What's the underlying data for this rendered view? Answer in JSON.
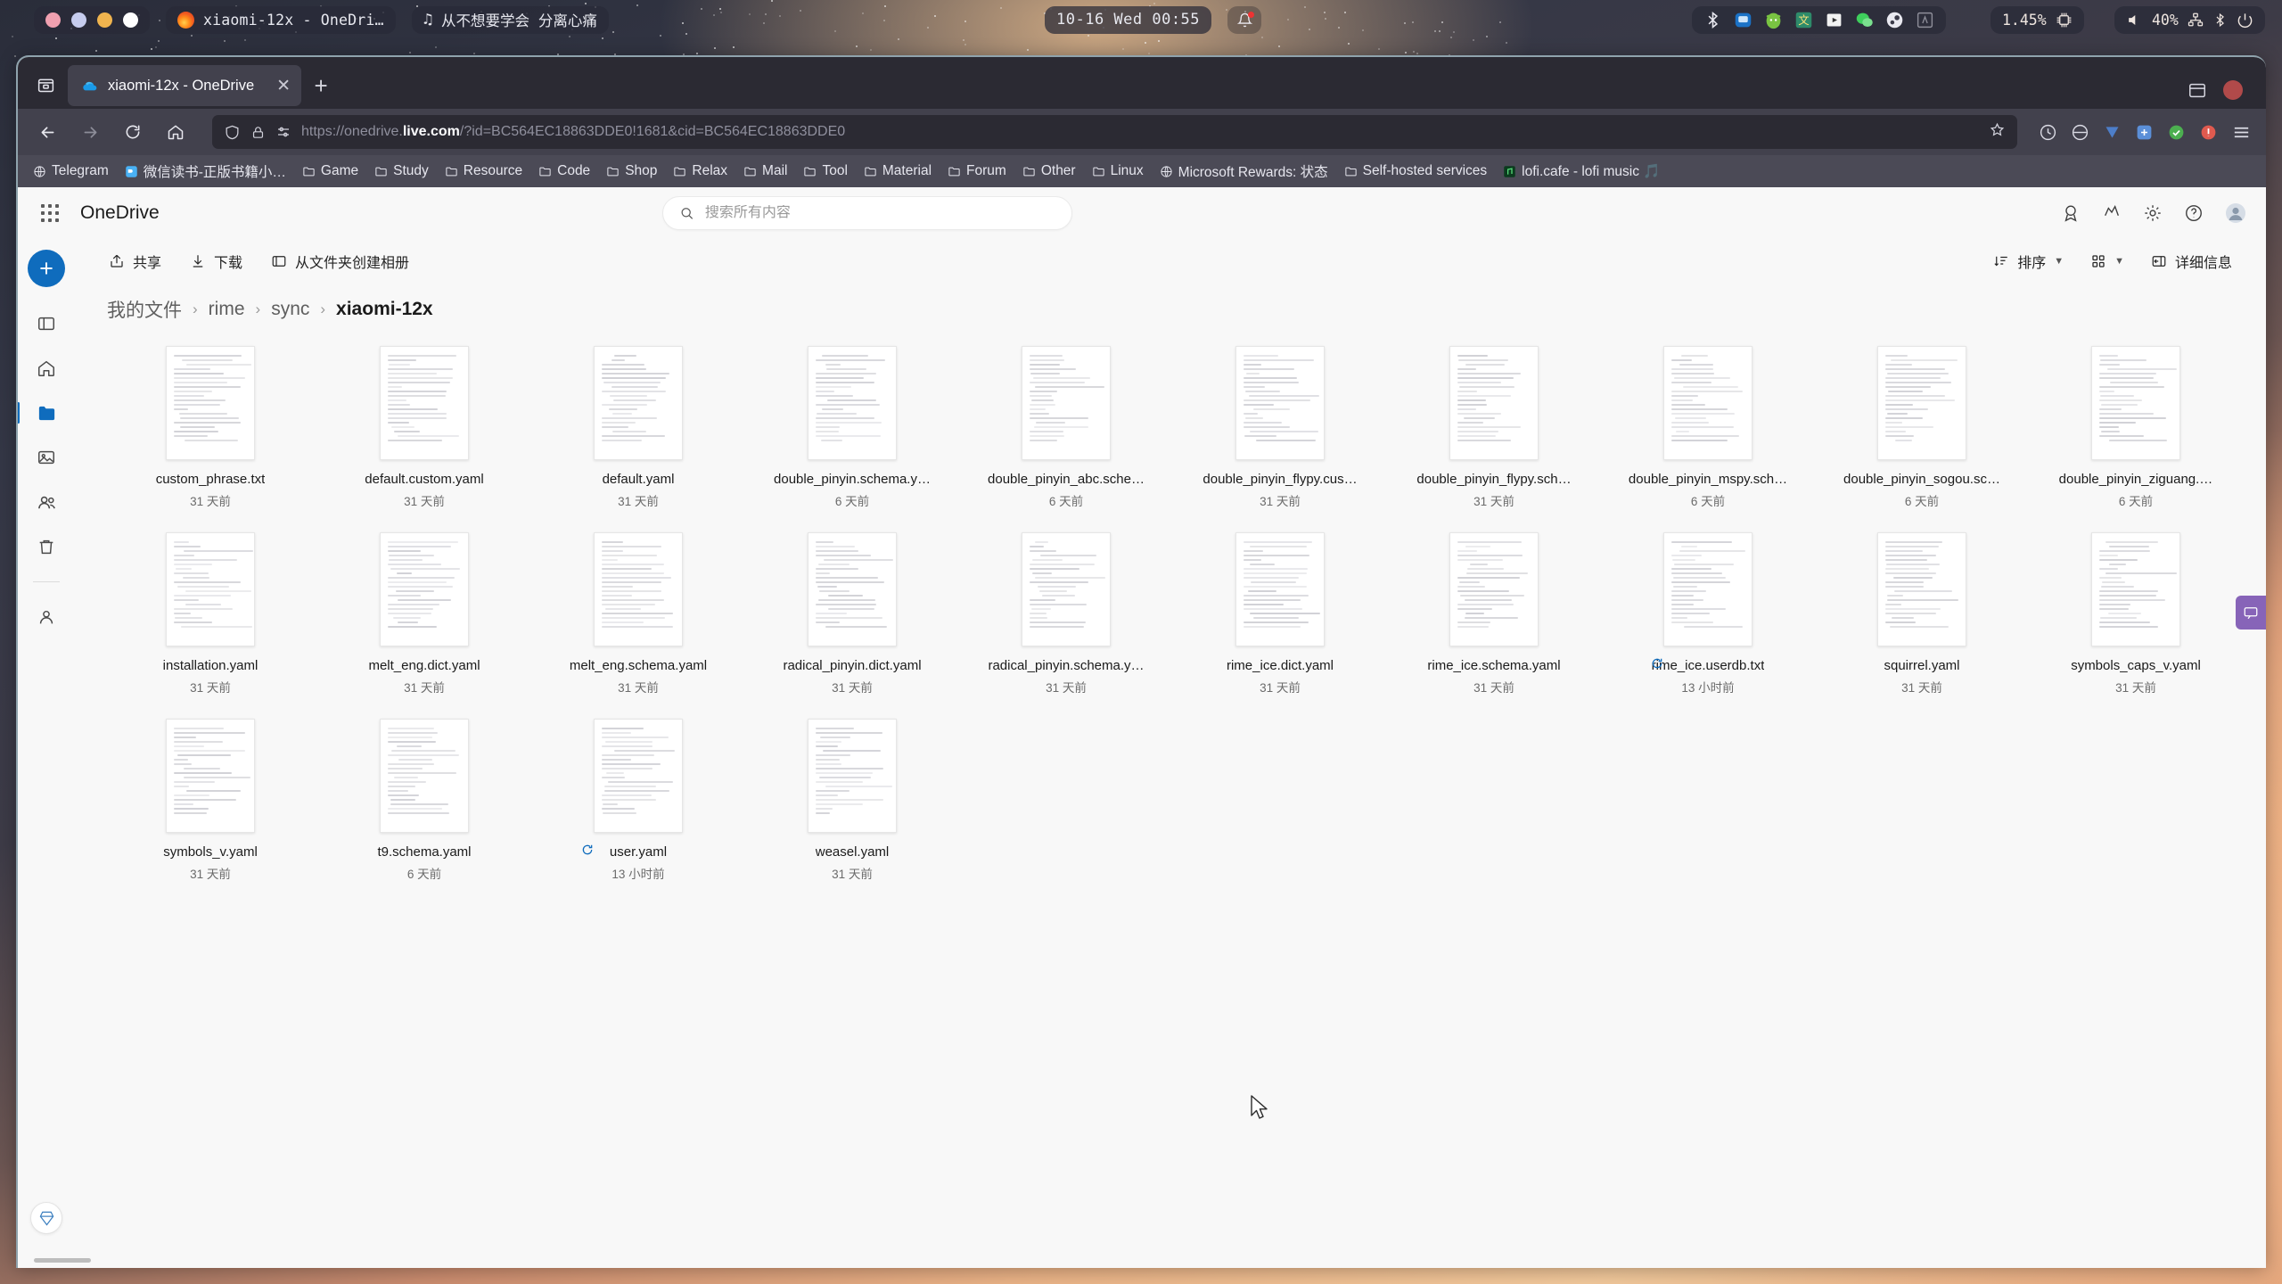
{
  "desktop": {
    "window_dots": [
      "#f0a0b0",
      "#c6ccee",
      "#f0b44e",
      "#ffffff"
    ],
    "active_window_title": "xiaomi-12x - OneDri…",
    "music_title": "从不想要学会 分离心痛",
    "clock": "10-16 Wed 00:55",
    "tray": {
      "icons": [
        "bluetooth-icon",
        "display-icon",
        "fcitx-cat-icon",
        "input-method-chinese-icon",
        "media-player-icon",
        "wechat-icon",
        "steam-icon",
        "app-icon"
      ],
      "cpu_usage": "1.45%",
      "volume": "40%",
      "network_icon": "network-icon",
      "bluetooth_icon": "bluetooth-icon",
      "power_icon": "power-icon"
    }
  },
  "browser": {
    "tab": {
      "title": "xiaomi-12x - OneDrive",
      "favicon": "onedrive-cloud-icon",
      "close_label": "✕"
    },
    "new_tab_label": "+",
    "url": {
      "scheme": "https://",
      "host_pre": "onedrive.",
      "host_bold": "live.com",
      "path": "/?id=BC564EC18863DDE0!1681&cid=BC564EC18863DDE0",
      "full": "https://onedrive.live.com/?id=BC564EC18863DDE0!1681&cid=BC564EC18863DDE0"
    },
    "bookmarks": [
      {
        "label": "Telegram",
        "icon": "globe-icon"
      },
      {
        "label": "微信读书-正版书籍小…",
        "icon": "wechat-read-icon"
      },
      {
        "label": "Game",
        "icon": "folder-icon"
      },
      {
        "label": "Study",
        "icon": "folder-icon"
      },
      {
        "label": "Resource",
        "icon": "folder-icon"
      },
      {
        "label": "Code",
        "icon": "folder-icon"
      },
      {
        "label": "Shop",
        "icon": "folder-icon"
      },
      {
        "label": "Relax",
        "icon": "folder-icon"
      },
      {
        "label": "Mail",
        "icon": "folder-icon"
      },
      {
        "label": "Tool",
        "icon": "folder-icon"
      },
      {
        "label": "Material",
        "icon": "folder-icon"
      },
      {
        "label": "Forum",
        "icon": "folder-icon"
      },
      {
        "label": "Other",
        "icon": "folder-icon"
      },
      {
        "label": "Linux",
        "icon": "folder-icon"
      },
      {
        "label": "Microsoft Rewards: 状态",
        "icon": "globe-icon"
      },
      {
        "label": "Self-hosted services",
        "icon": "folder-icon"
      },
      {
        "label": "lofi.cafe - lofi music 🎵",
        "icon": "lofi-icon"
      }
    ]
  },
  "app": {
    "brand": "OneDrive",
    "search_placeholder": "搜索所有内容",
    "search_value": "",
    "toolbar": {
      "share": "共享",
      "download": "下载",
      "create_album": "从文件夹创建相册",
      "sort": "排序",
      "details": "详细信息"
    },
    "breadcrumb": {
      "items": [
        "我的文件",
        "rime",
        "sync"
      ],
      "current": "xiaomi-12x",
      "separator": "›"
    },
    "rail": {
      "new_label": "+",
      "items": [
        "sidebar-toggle",
        "home",
        "my-files",
        "photos",
        "shared",
        "recycle-bin",
        "people"
      ]
    },
    "files": [
      {
        "name": "custom_phrase.txt",
        "date": "31 天前",
        "seed": 11,
        "syncing": false
      },
      {
        "name": "default.custom.yaml",
        "date": "31 天前",
        "seed": 23,
        "syncing": false
      },
      {
        "name": "default.yaml",
        "date": "31 天前",
        "seed": 37,
        "syncing": false
      },
      {
        "name": "double_pinyin.schema.y…",
        "date": "6 天前",
        "seed": 42,
        "syncing": false
      },
      {
        "name": "double_pinyin_abc.sche…",
        "date": "6 天前",
        "seed": 51,
        "syncing": false
      },
      {
        "name": "double_pinyin_flypy.cus…",
        "date": "31 天前",
        "seed": 63,
        "syncing": false
      },
      {
        "name": "double_pinyin_flypy.sch…",
        "date": "31 天前",
        "seed": 74,
        "syncing": false
      },
      {
        "name": "double_pinyin_mspy.sch…",
        "date": "6 天前",
        "seed": 85,
        "syncing": false
      },
      {
        "name": "double_pinyin_sogou.sc…",
        "date": "6 天前",
        "seed": 96,
        "syncing": false
      },
      {
        "name": "double_pinyin_ziguang.…",
        "date": "6 天前",
        "seed": 107,
        "syncing": false
      },
      {
        "name": "installation.yaml",
        "date": "31 天前",
        "seed": 118,
        "syncing": false
      },
      {
        "name": "melt_eng.dict.yaml",
        "date": "31 天前",
        "seed": 129,
        "syncing": false
      },
      {
        "name": "melt_eng.schema.yaml",
        "date": "31 天前",
        "seed": 131,
        "syncing": false
      },
      {
        "name": "radical_pinyin.dict.yaml",
        "date": "31 天前",
        "seed": 142,
        "syncing": false
      },
      {
        "name": "radical_pinyin.schema.y…",
        "date": "31 天前",
        "seed": 153,
        "syncing": false
      },
      {
        "name": "rime_ice.dict.yaml",
        "date": "31 天前",
        "seed": 164,
        "syncing": false
      },
      {
        "name": "rime_ice.schema.yaml",
        "date": "31 天前",
        "seed": 175,
        "syncing": false
      },
      {
        "name": "rime_ice.userdb.txt",
        "date": "13 小时前",
        "seed": 186,
        "syncing": true
      },
      {
        "name": "squirrel.yaml",
        "date": "31 天前",
        "seed": 197,
        "syncing": false
      },
      {
        "name": "symbols_caps_v.yaml",
        "date": "31 天前",
        "seed": 208,
        "syncing": false
      },
      {
        "name": "symbols_v.yaml",
        "date": "31 天前",
        "seed": 219,
        "syncing": false
      },
      {
        "name": "t9.schema.yaml",
        "date": "6 天前",
        "seed": 230,
        "syncing": false
      },
      {
        "name": "user.yaml",
        "date": "13 小时前",
        "seed": 241,
        "syncing": true
      },
      {
        "name": "weasel.yaml",
        "date": "31 天前",
        "seed": 252,
        "syncing": false
      }
    ]
  },
  "colors": {
    "accent": "#0f6cbd",
    "browser_chrome": "#42414d",
    "tabstrip": "#2b2a33",
    "bookmark_bar": "#4b4a56",
    "app_bg": "#f8f8f8",
    "fab": "#8764b8"
  }
}
